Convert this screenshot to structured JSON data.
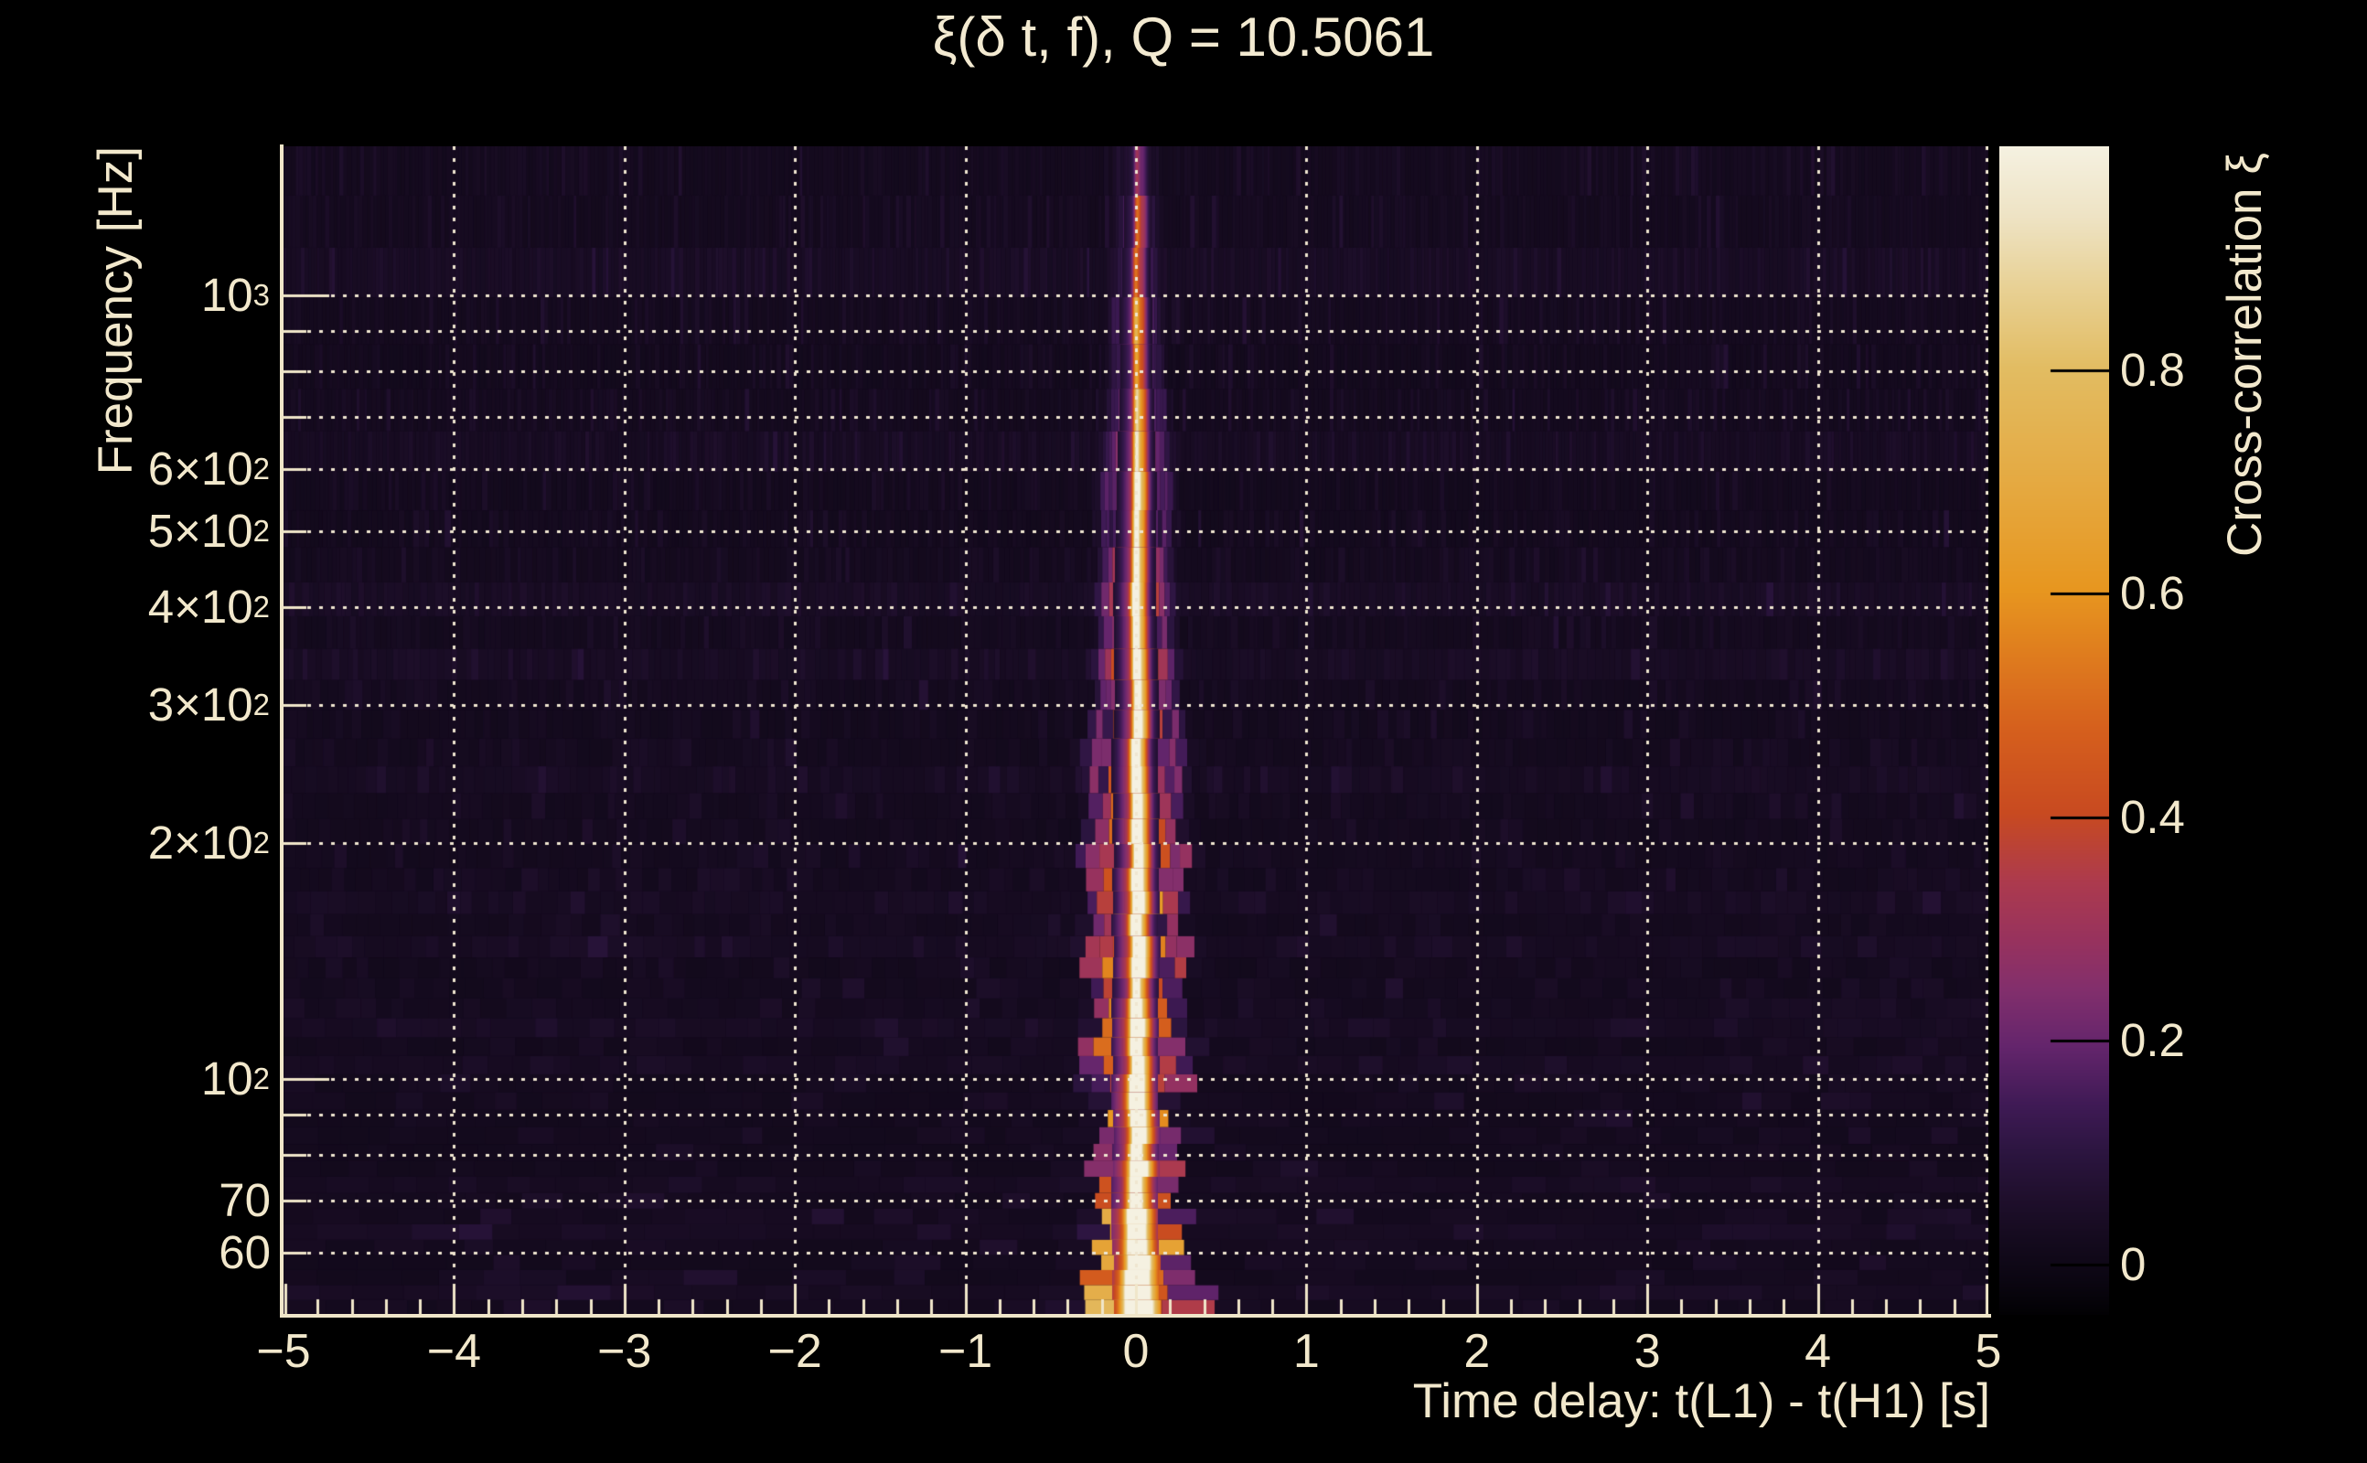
{
  "title": "ξ(δ t, f), Q = 10.5061",
  "colors": {
    "background": "#000000",
    "text": "#f2e8cc",
    "axis": "#f0e6c9",
    "gridline": "#efe6d0",
    "colorbar_tick": "#000000"
  },
  "chart_data": {
    "type": "heatmap",
    "title": "ξ(δ t, f), Q = 10.5061",
    "q_value": 10.5061,
    "xlabel": "Time delay: t(L1) - t(H1) [s]",
    "ylabel": "Frequency [Hz]",
    "colorbar_label": "Cross-correlation ξ",
    "x_range": [
      -5,
      5
    ],
    "x_scale": "linear",
    "y_range_hz": [
      50,
      1550
    ],
    "y_scale": "log",
    "grid": true,
    "x_major_ticks": [
      {
        "v": -5,
        "label": "−5"
      },
      {
        "v": -4,
        "label": "−4"
      },
      {
        "v": -3,
        "label": "−3"
      },
      {
        "v": -2,
        "label": "−2"
      },
      {
        "v": -1,
        "label": "−1"
      },
      {
        "v": 0,
        "label": "0"
      },
      {
        "v": 1,
        "label": "1"
      },
      {
        "v": 2,
        "label": "2"
      },
      {
        "v": 3,
        "label": "3"
      },
      {
        "v": 4,
        "label": "4"
      },
      {
        "v": 5,
        "label": "5"
      }
    ],
    "x_minor_tick_step": 0.2,
    "x_gridlines": [
      -4,
      -3,
      -2,
      -1,
      0,
      1,
      2,
      3,
      4,
      5
    ],
    "y_ticks": [
      {
        "hz": 1000,
        "main": "10",
        "sup": "3"
      },
      {
        "hz": 600,
        "main": "6×10",
        "sup": "2"
      },
      {
        "hz": 500,
        "main": "5×10",
        "sup": "2"
      },
      {
        "hz": 400,
        "main": "4×10",
        "sup": "2"
      },
      {
        "hz": 300,
        "main": "3×10",
        "sup": "2"
      },
      {
        "hz": 200,
        "main": "2×10",
        "sup": "2"
      },
      {
        "hz": 100,
        "main": "10",
        "sup": "2"
      },
      {
        "hz": 70,
        "main": "70",
        "sup": ""
      },
      {
        "hz": 60,
        "main": "60",
        "sup": ""
      }
    ],
    "y_gridlines_hz": [
      60,
      70,
      80,
      90,
      100,
      200,
      300,
      400,
      500,
      600,
      700,
      800,
      900,
      1000
    ],
    "colorbar": {
      "value_range": [
        -0.045,
        1.0
      ],
      "ticks": [
        {
          "v": 0.8,
          "label": "0.8"
        },
        {
          "v": 0.6,
          "label": "0.6"
        },
        {
          "v": 0.4,
          "label": "0.4"
        },
        {
          "v": 0.2,
          "label": "0.2"
        },
        {
          "v": 0,
          "label": "0"
        }
      ],
      "colormap_stops": [
        [
          0.0,
          "#020103"
        ],
        [
          0.03,
          "#0b0612"
        ],
        [
          0.07,
          "#160b20"
        ],
        [
          0.1,
          "#1f0f2c"
        ],
        [
          0.14,
          "#2c1540"
        ],
        [
          0.18,
          "#3f1a55"
        ],
        [
          0.23,
          "#64256c"
        ],
        [
          0.28,
          "#832f6c"
        ],
        [
          0.32,
          "#97325e"
        ],
        [
          0.37,
          "#ac3a4e"
        ],
        [
          0.43,
          "#c84a20"
        ],
        [
          0.5,
          "#d55f1d"
        ],
        [
          0.56,
          "#de7a1e"
        ],
        [
          0.62,
          "#e7961f"
        ],
        [
          0.7,
          "#e5a73d"
        ],
        [
          0.81,
          "#e2bc62"
        ],
        [
          0.88,
          "#e8d195"
        ],
        [
          0.94,
          "#eee3c4"
        ],
        [
          1.0,
          "#f5f1e1"
        ]
      ]
    },
    "signal": {
      "peak_time_delay_s": 0,
      "peak_xi": 1.0,
      "background_xi_typical": 0.03,
      "background_xi_range": [
        0,
        0.09
      ],
      "ridge_bands": [
        {
          "f_hz": 50,
          "xi": 1.0,
          "core_width_s": 0.05,
          "lobe_xi": 0.5,
          "lobe_offset_s": 0.17,
          "glow_width_s": 0.2
        },
        {
          "f_hz": 60,
          "xi": 1.0,
          "core_width_s": 0.032,
          "lobe_xi": 0.5,
          "lobe_offset_s": 0.11,
          "glow_width_s": 0.1
        },
        {
          "f_hz": 80,
          "xi": 0.98,
          "core_width_s": 0.026,
          "lobe_xi": 0.42,
          "lobe_offset_s": 0.1,
          "glow_width_s": 0.08
        },
        {
          "f_hz": 100,
          "xi": 0.93,
          "core_width_s": 0.022,
          "lobe_xi": 0.5,
          "lobe_offset_s": 0.12,
          "glow_width_s": 0.07
        },
        {
          "f_hz": 140,
          "xi": 0.9,
          "core_width_s": 0.02,
          "lobe_xi": 0.55,
          "lobe_offset_s": 0.13,
          "glow_width_s": 0.06
        },
        {
          "f_hz": 200,
          "xi": 0.86,
          "core_width_s": 0.018,
          "lobe_xi": 0.5,
          "lobe_offset_s": 0.13,
          "glow_width_s": 0.055
        },
        {
          "f_hz": 300,
          "xi": 0.8,
          "core_width_s": 0.016,
          "lobe_xi": 0.45,
          "lobe_offset_s": 0.11,
          "glow_width_s": 0.05
        },
        {
          "f_hz": 450,
          "xi": 0.72,
          "core_width_s": 0.015,
          "lobe_xi": 0.4,
          "lobe_offset_s": 0.09,
          "glow_width_s": 0.045
        },
        {
          "f_hz": 650,
          "xi": 0.62,
          "core_width_s": 0.014,
          "lobe_xi": 0.35,
          "lobe_offset_s": 0.075,
          "glow_width_s": 0.04
        },
        {
          "f_hz": 900,
          "xi": 0.5,
          "core_width_s": 0.013,
          "lobe_xi": 0.3,
          "lobe_offset_s": 0.065,
          "glow_width_s": 0.035
        },
        {
          "f_hz": 1200,
          "xi": 0.36,
          "core_width_s": 0.012,
          "lobe_xi": 0.22,
          "lobe_offset_s": 0.055,
          "glow_width_s": 0.03
        },
        {
          "f_hz": 1550,
          "xi": 0.2,
          "core_width_s": 0.012,
          "lobe_xi": 0.15,
          "lobe_offset_s": 0.05,
          "glow_width_s": 0.03
        }
      ]
    }
  }
}
